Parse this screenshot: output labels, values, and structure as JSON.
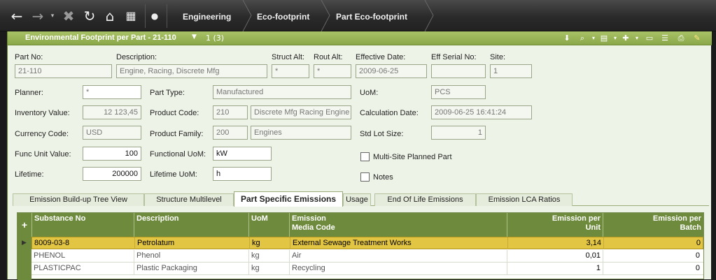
{
  "breadcrumb": [
    "Engineering",
    "Eco-footprint",
    "Part Eco-footprint"
  ],
  "window": {
    "title": "Environmental Footprint per Part - 21-110",
    "record_count": "1 (3)"
  },
  "labels": {
    "part_no": "Part No:",
    "description": "Description:",
    "struct_alt": "Struct Alt:",
    "rout_alt": "Rout Alt:",
    "effective_date": "Effective Date:",
    "eff_serial_no": "Eff Serial No:",
    "site": "Site:",
    "planner": "Planner:",
    "part_type": "Part Type:",
    "uom": "UoM:",
    "inventory_value": "Inventory Value:",
    "product_code": "Product Code:",
    "calculation_date": "Calculation Date:",
    "currency_code": "Currency Code:",
    "product_family": "Product Family:",
    "std_lot_size": "Std Lot Size:",
    "func_unit_value": "Func Unit Value:",
    "functional_uom": "Functional UoM:",
    "multi_site": "Multi-Site Planned Part",
    "lifetime": "Lifetime:",
    "lifetime_uom": "Lifetime UoM:",
    "notes": "Notes"
  },
  "values": {
    "part_no": "21-110",
    "description": "Engine, Racing, Discrete Mfg",
    "struct_alt": "*",
    "rout_alt": "*",
    "effective_date": "2009-06-25",
    "eff_serial_no": "",
    "site": "1",
    "planner": "*",
    "part_type": "Manufactured",
    "uom": "PCS",
    "inventory_value": "12 123,45",
    "product_code": "210",
    "product_code_desc": "Discrete Mfg Racing Engine",
    "calculation_date": "2009-06-25 16:41:24",
    "currency_code": "USD",
    "product_family": "200",
    "product_family_desc": "Engines",
    "std_lot_size": "1",
    "func_unit_value": "100",
    "functional_uom": "kW",
    "lifetime": "200000",
    "lifetime_uom": "h"
  },
  "tabs": [
    "Emission Build-up Tree View",
    "Structure Multilevel",
    "Part Specific Emissions",
    "Usage",
    "End Of Life Emissions",
    "Emission LCA Ratios"
  ],
  "grid": {
    "headers": [
      "Substance No",
      "Description",
      "UoM",
      "Emission\nMedia Code",
      "Emission per\nUnit",
      "Emission per\nBatch"
    ],
    "rows": [
      [
        "8009-03-8",
        "Petrolatum",
        "kg",
        "External Sewage Treatment Works",
        "3,14",
        "0"
      ],
      [
        "PHENOL",
        "Phenol",
        "kg",
        "Air",
        "0,01",
        "0"
      ],
      [
        "PLASTICPAC",
        "Plastic Packaging",
        "kg",
        "Recycling",
        "1",
        "0"
      ]
    ]
  }
}
